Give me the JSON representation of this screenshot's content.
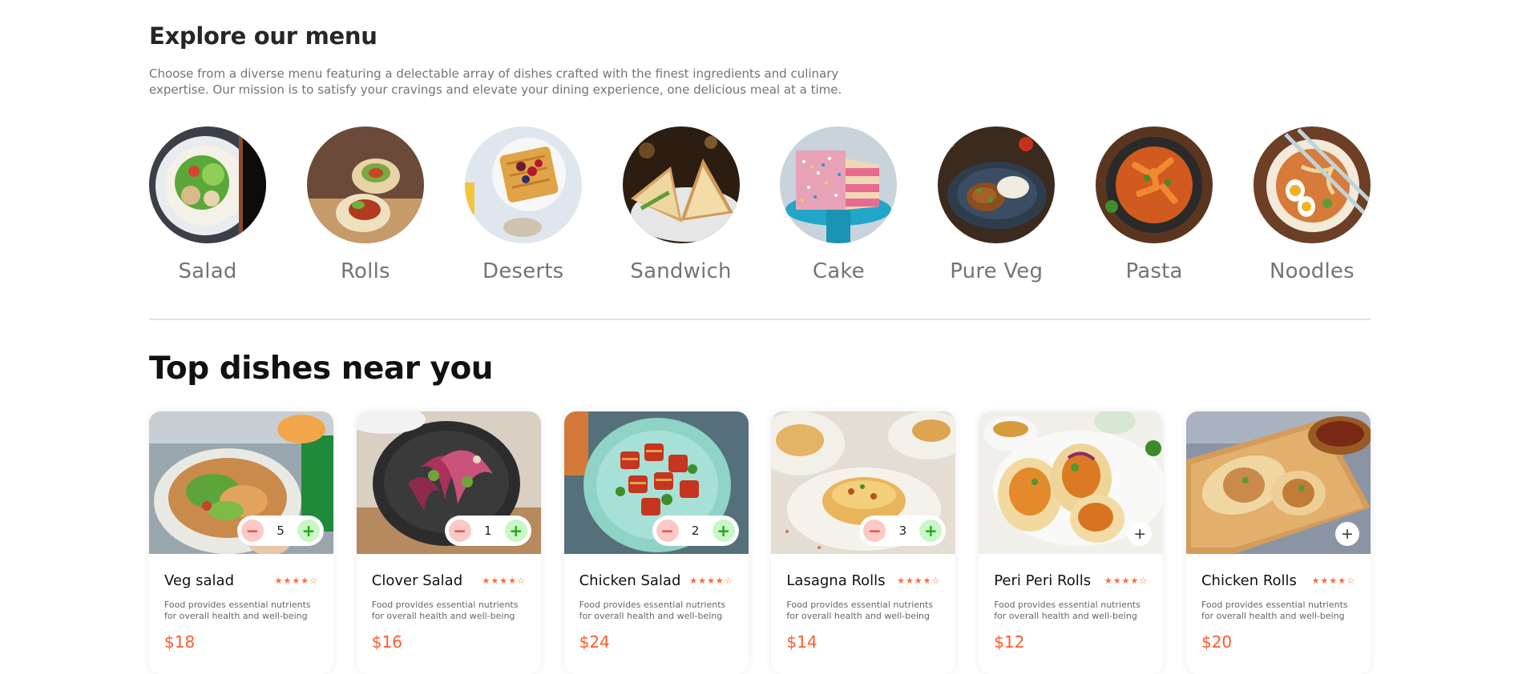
{
  "explore": {
    "title": "Explore our menu",
    "description": "Choose from a diverse menu featuring a delectable array of dishes crafted with the finest ingredients and culinary expertise. Our mission is to satisfy your cravings and elevate your dining experience, one delicious meal at a time."
  },
  "menu": [
    {
      "label": "Salad",
      "image": "salad-bowl"
    },
    {
      "label": "Rolls",
      "image": "wrap-rolls"
    },
    {
      "label": "Deserts",
      "image": "waffle-berries"
    },
    {
      "label": "Sandwich",
      "image": "toasted-sandwich"
    },
    {
      "label": "Cake",
      "image": "layer-cake"
    },
    {
      "label": "Pure Veg",
      "image": "curry-rice"
    },
    {
      "label": "Pasta",
      "image": "penne-pasta"
    },
    {
      "label": "Noodles",
      "image": "ramen-bowl"
    }
  ],
  "top_dishes": {
    "title": "Top dishes near you",
    "items": [
      {
        "name": "Veg salad",
        "rating": "★★★★☆",
        "description": "Food provides essential nutrients for overall health and well-being",
        "price": "$18",
        "count": "5",
        "image": "salad-plate"
      },
      {
        "name": "Clover Salad",
        "rating": "★★★★☆",
        "description": "Food provides essential nutrients for overall health and well-being",
        "price": "$16",
        "count": "1",
        "image": "clover-plate"
      },
      {
        "name": "Chicken Salad",
        "rating": "★★★★☆",
        "description": "Food provides essential nutrients for overall health and well-being",
        "price": "$24",
        "count": "2",
        "image": "chicken-salad-plate"
      },
      {
        "name": "Lasagna Rolls",
        "rating": "★★★★☆",
        "description": "Food provides essential nutrients for overall health and well-being",
        "price": "$14",
        "count": "3",
        "image": "lasagna-plate"
      },
      {
        "name": "Peri Peri Rolls",
        "rating": "★★★★☆",
        "description": "Food provides essential nutrients for overall health and well-being",
        "price": "$12",
        "count": null,
        "image": "peri-rolls"
      },
      {
        "name": "Chicken Rolls",
        "rating": "★★★★☆",
        "description": "Food provides essential nutrients for overall health and well-being",
        "price": "$20",
        "count": null,
        "image": "chicken-rolls"
      }
    ]
  },
  "controls": {
    "minus": "−",
    "plus": "+",
    "add": "+"
  },
  "colors": {
    "accent": "#ff5a2b",
    "star": "#ff6a3d",
    "minus_bg": "#fcc9c5",
    "plus_bg": "#c9f7c7"
  }
}
